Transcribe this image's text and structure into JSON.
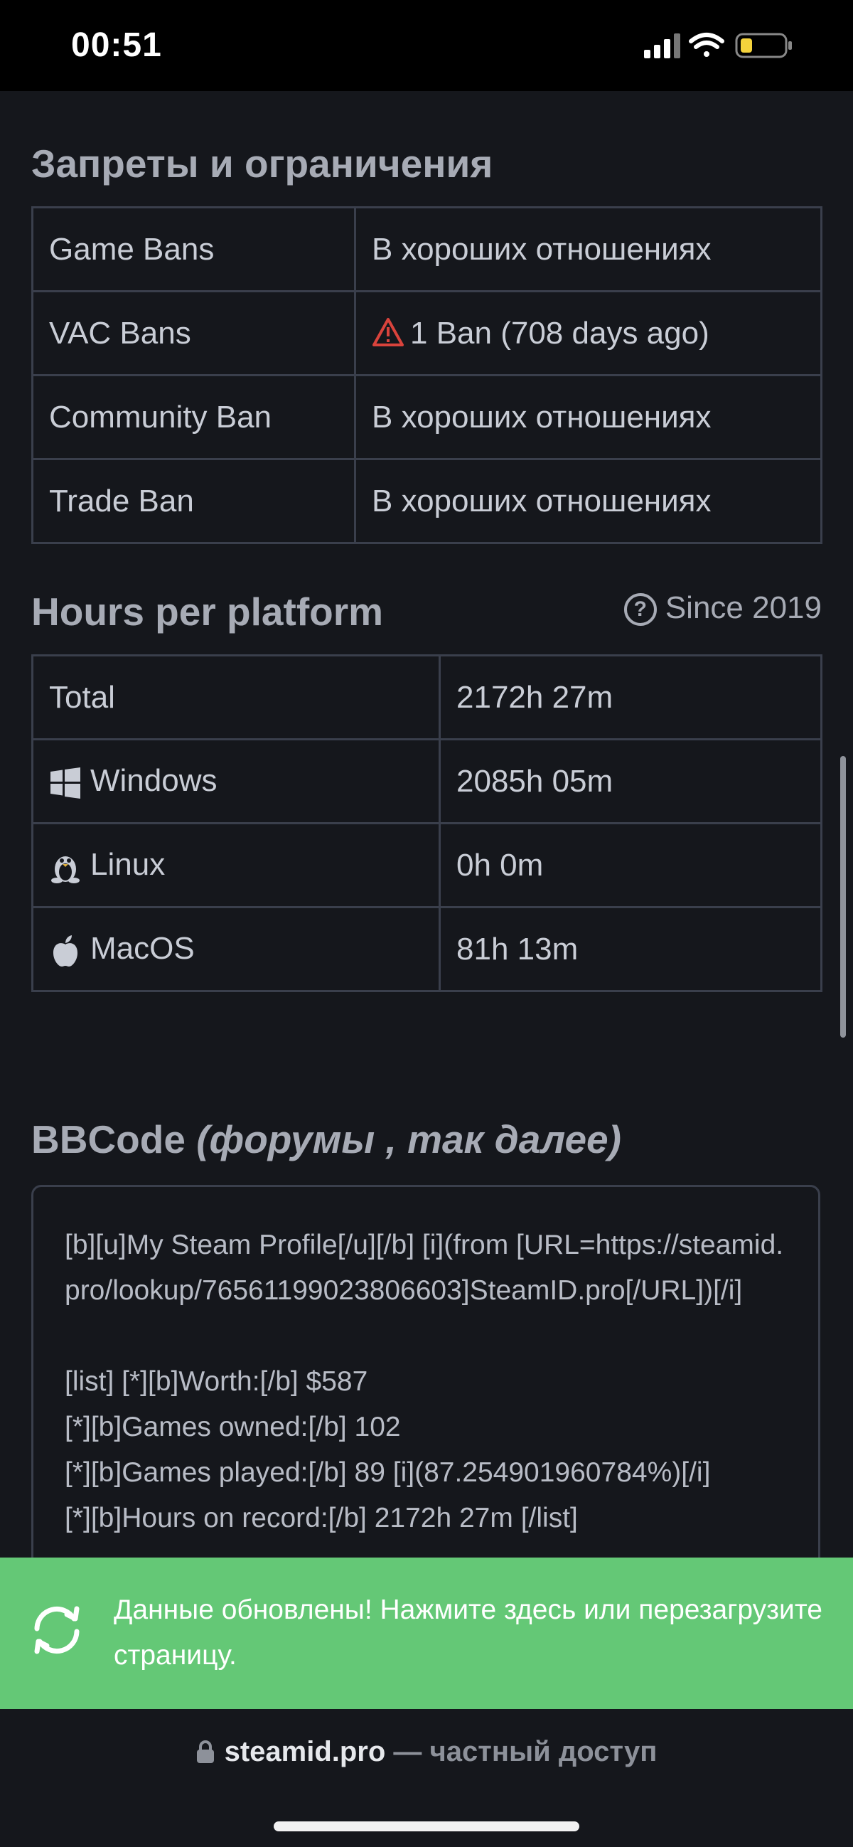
{
  "status_bar": {
    "time": "00:51"
  },
  "bans": {
    "title": "Запреты и ограничения",
    "rows": [
      {
        "label": "Game Bans",
        "value": "В хороших отношениях",
        "status": "good"
      },
      {
        "label": "VAC Bans",
        "value": "1 Ban (708 days ago)",
        "status": "bad"
      },
      {
        "label": "Community Ban",
        "value": "В хороших отношениях",
        "status": "good"
      },
      {
        "label": "Trade Ban",
        "value": "В хороших отношениях",
        "status": "good"
      }
    ]
  },
  "hours": {
    "title": "Hours per platform",
    "since": "Since 2019",
    "rows": [
      {
        "label": "Total",
        "value": "2172h 27m",
        "icon": ""
      },
      {
        "label": "Windows",
        "value": "2085h 05m",
        "icon": "windows-icon"
      },
      {
        "label": "Linux",
        "value": "0h 0m",
        "icon": "linux-icon"
      },
      {
        "label": "MacOS",
        "value": "81h 13m",
        "icon": "apple-icon"
      }
    ]
  },
  "bbcode": {
    "title_plain": "BBCode",
    "title_italic": "(форумы , так далее)",
    "text": "[b][u]My Steam Profile[/u][/b] [i](from [URL=https://steamid.pro/lookup/76561199023806603]SteamID.pro[/URL])[/i]\n\n[list] [*][b]Worth:[/b] $587\n[*][b]Games owned:[/b] 102\n[*][b]Games played:[/b] 89 [i](87.254901960784%)[/i]\n[*][b]Hours on record:[/b] 2172h 27m [/list]"
  },
  "toast": {
    "text": "Данные обновлены! Нажмите здесь или перезагрузите страницу."
  },
  "browser": {
    "domain": "steamid.pro",
    "separator": "—",
    "access": "частный доступ"
  },
  "colors": {
    "good": "#5fd15a",
    "bad": "#d9433c",
    "toast": "#64c876",
    "background": "#15171c"
  }
}
